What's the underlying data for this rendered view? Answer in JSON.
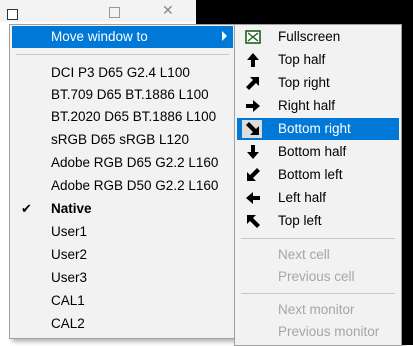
{
  "main_menu": {
    "move_window": "Move window to",
    "presets": [
      "DCI P3 D65 G2.4 L100",
      "BT.709 D65 BT.1886 L100",
      "BT.2020 D65 BT.1886 L100",
      "sRGB D65 sRGB L120",
      "Adobe RGB D65 G2.2 L160",
      "Adobe RGB D50 G2.2 L160"
    ],
    "native": "Native",
    "native_check": "✔",
    "users": [
      "User1",
      "User2",
      "User3"
    ],
    "cal": [
      "CAL1",
      "CAL2"
    ]
  },
  "sub_menu": {
    "positions": [
      {
        "label": "Fullscreen",
        "icon": "fullscreen-icon"
      },
      {
        "label": "Top half",
        "icon": "arrow-up-icon"
      },
      {
        "label": "Top right",
        "icon": "arrow-up-right-icon"
      },
      {
        "label": "Right half",
        "icon": "arrow-right-icon"
      },
      {
        "label": "Bottom right",
        "icon": "arrow-down-right-icon"
      },
      {
        "label": "Bottom half",
        "icon": "arrow-down-icon"
      },
      {
        "label": "Bottom left",
        "icon": "arrow-down-left-icon"
      },
      {
        "label": "Left half",
        "icon": "arrow-left-icon"
      },
      {
        "label": "Top left",
        "icon": "arrow-up-left-icon"
      }
    ],
    "cells": [
      "Next cell",
      "Previous cell"
    ],
    "monitors": [
      "Next monitor",
      "Previous monitor"
    ]
  },
  "colors": {
    "highlight": "#0078d7",
    "disabled_text": "#a6a6a6",
    "menu_bg": "#f2f2f2"
  }
}
